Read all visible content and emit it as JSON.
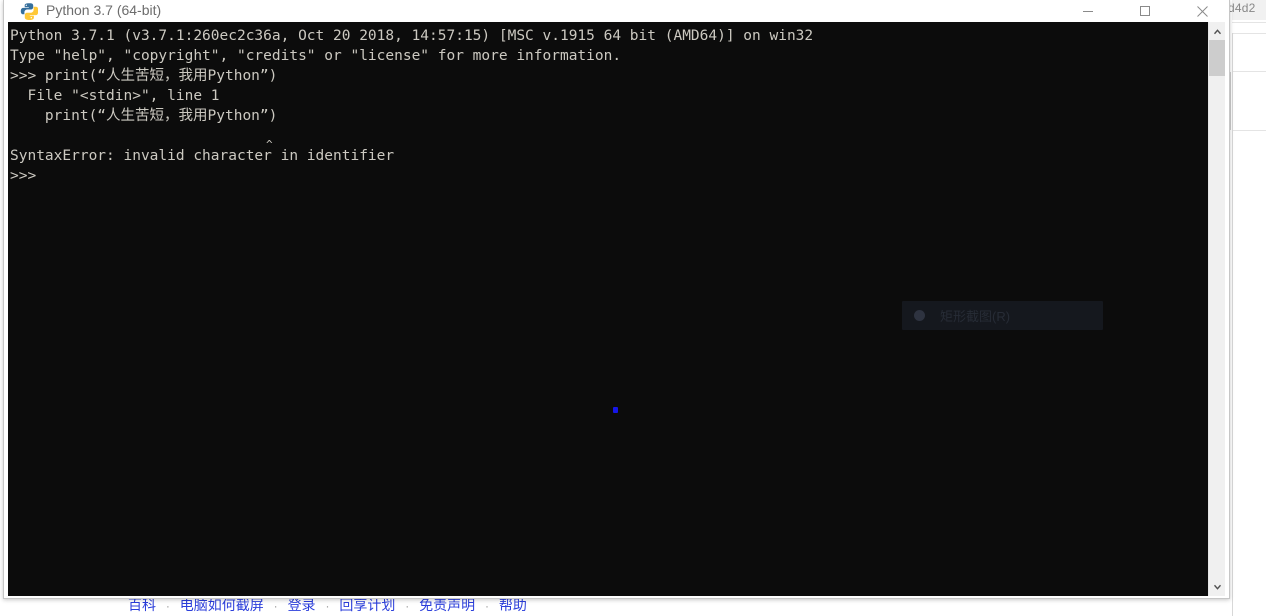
{
  "window": {
    "title": "Python 3.7 (64-bit)",
    "icon": "python-logo-icon",
    "controls": {
      "minimize": "minimize-button",
      "maximize": "maximize-button",
      "close": "close-button"
    }
  },
  "console": {
    "background_color": "#0c0c0c",
    "text_color": "#ccc9c1",
    "caret_marker": "^",
    "lines": [
      "Python 3.7.1 (v3.7.1:260ec2c36a, Oct 20 2018, 14:57:15) [MSC v.1915 64 bit (AMD64)] on win32",
      "Type \"help\", \"copyright\", \"credits\" or \"license\" for more information.",
      ">>> print(“人生苦短，我用Python”)",
      "  File \"<stdin>\", line 1",
      "    print(“人生苦短，我用Python”)",
      "",
      "SyntaxError: invalid character in identifier",
      ">>> "
    ],
    "text": "Python 3.7.1 (v3.7.1:260ec2c36a, Oct 20 2018, 14:57:15) [MSC v.1915 64 bit (AMD64)] on win32\nType \"help\", \"copyright\", \"credits\" or \"license\" for more information.\n>>> print(“人生苦短，我用Python”)\n  File \"<stdin>\", line 1\n    print(“人生苦短，我用Python”)\n\nSyntaxError: invalid character in identifier\n>>> "
  },
  "snip_popup": {
    "label": "矩形截图(R)",
    "icon": "record-dot-icon",
    "background_color": "#15181e"
  },
  "scrollbar": {
    "up_arrow": "scroll-up-arrow-icon",
    "down_arrow": "scroll-down-arrow-icon"
  },
  "background_page": {
    "partial_text": "d4d2",
    "footer": {
      "separator": "·",
      "link_color": "#2b3edb",
      "links": [
        "百科",
        "电脑如何截屏",
        "登录",
        "回享计划",
        "免责声明",
        "帮助"
      ]
    }
  }
}
